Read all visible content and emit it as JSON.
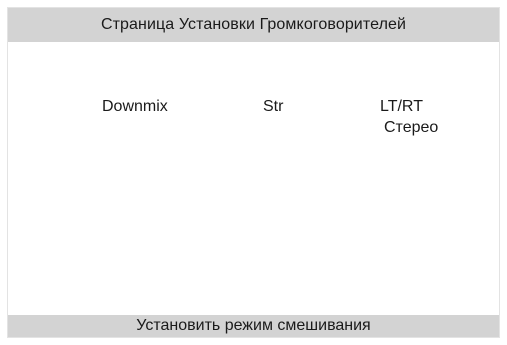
{
  "header": {
    "title": "Страница Установки Громкоговорителей"
  },
  "menu": {
    "item_downmix": "Downmix",
    "item_str": "Str",
    "item_mode_line1": "LT/RT",
    "item_mode_line2": "Стерео"
  },
  "footer": {
    "status": "Установить режим смешивания"
  },
  "colors": {
    "bar_background": "#d3d3d3",
    "page_background": "#ffffff",
    "text": "#1a1a1a"
  }
}
